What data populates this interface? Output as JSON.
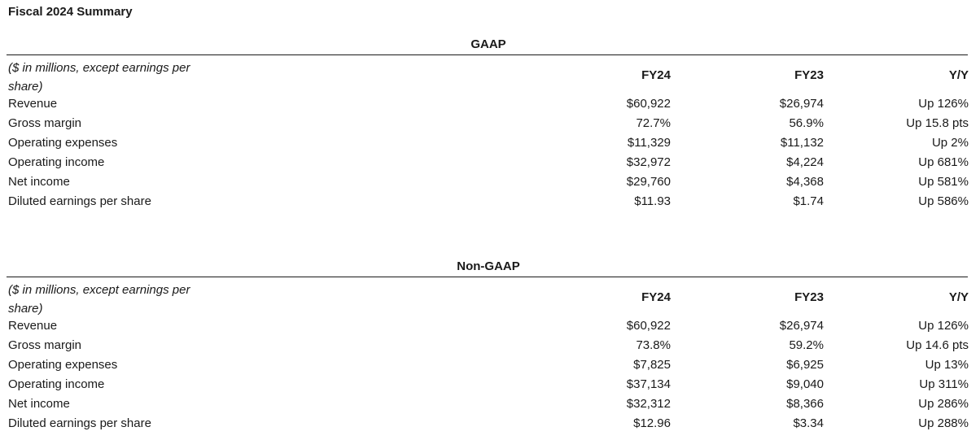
{
  "title": "Fiscal 2024 Summary",
  "sections": [
    {
      "name": "GAAP",
      "units": "($ in millions, except earnings per share)",
      "columns": [
        "FY24",
        "FY23",
        "Y/Y"
      ],
      "rows": [
        {
          "label": "Revenue",
          "fy24": "$60,922",
          "fy23": "$26,974",
          "yy": "Up 126%"
        },
        {
          "label": "Gross margin",
          "fy24": "72.7%",
          "fy23": "56.9%",
          "yy": "Up 15.8 pts"
        },
        {
          "label": "Operating expenses",
          "fy24": "$11,329",
          "fy23": "$11,132",
          "yy": "Up 2%"
        },
        {
          "label": "Operating income",
          "fy24": "$32,972",
          "fy23": "$4,224",
          "yy": "Up 681%"
        },
        {
          "label": "Net income",
          "fy24": "$29,760",
          "fy23": "$4,368",
          "yy": "Up 581%"
        },
        {
          "label": "Diluted earnings per share",
          "fy24": "$11.93",
          "fy23": "$1.74",
          "yy": "Up 586%"
        }
      ]
    },
    {
      "name": "Non-GAAP",
      "units": "($ in millions, except earnings per share)",
      "columns": [
        "FY24",
        "FY23",
        "Y/Y"
      ],
      "rows": [
        {
          "label": "Revenue",
          "fy24": "$60,922",
          "fy23": "$26,974",
          "yy": "Up 126%"
        },
        {
          "label": "Gross margin",
          "fy24": "73.8%",
          "fy23": "59.2%",
          "yy": "Up 14.6 pts"
        },
        {
          "label": "Operating expenses",
          "fy24": "$7,825",
          "fy23": "$6,925",
          "yy": "Up 13%"
        },
        {
          "label": "Operating income",
          "fy24": "$37,134",
          "fy23": "$9,040",
          "yy": "Up 311%"
        },
        {
          "label": "Net income",
          "fy24": "$32,312",
          "fy23": "$8,366",
          "yy": "Up 286%"
        },
        {
          "label": "Diluted earnings per share",
          "fy24": "$12.96",
          "fy23": "$3.34",
          "yy": "Up 288%"
        }
      ]
    }
  ]
}
